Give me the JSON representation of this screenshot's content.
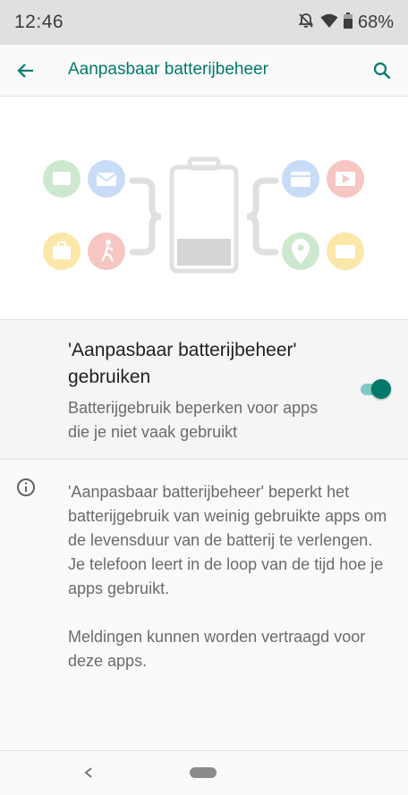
{
  "status_bar": {
    "time": "12:46",
    "battery_percent": "68%",
    "icons": [
      "alarm-off-icon",
      "wifi-icon",
      "battery-icon"
    ]
  },
  "app_bar": {
    "title": "Aanpasbaar batterijbeheer",
    "back_icon": "arrow-back-icon",
    "search_icon": "search-icon",
    "accent_color": "#00796b"
  },
  "illustration": {
    "left_icons": [
      "chat-icon",
      "mail-icon",
      "briefcase-icon",
      "running-icon"
    ],
    "right_icons": [
      "calendar-icon",
      "video-icon",
      "map-pin-icon",
      "message-icon"
    ],
    "battery_level": 0.27
  },
  "setting": {
    "title": "'Aanpasbaar batterijbeheer' gebruiken",
    "summary": "Batterijgebruik beperken voor apps die je niet vaak gebruikt",
    "enabled": true
  },
  "info": {
    "icon": "info-icon",
    "paragraph_1": "'Aanpasbaar batterijbeheer' beperkt het batterijgebruik van weinig gebruikte apps om de levensduur van de batterij te verlengen. Je telefoon leert in de loop van de tijd hoe je apps gebruikt.",
    "paragraph_2": "Meldingen kunnen worden vertraagd voor deze apps."
  },
  "nav_bar": {
    "back_icon": "nav-back-icon",
    "home_icon": "nav-home-pill"
  }
}
